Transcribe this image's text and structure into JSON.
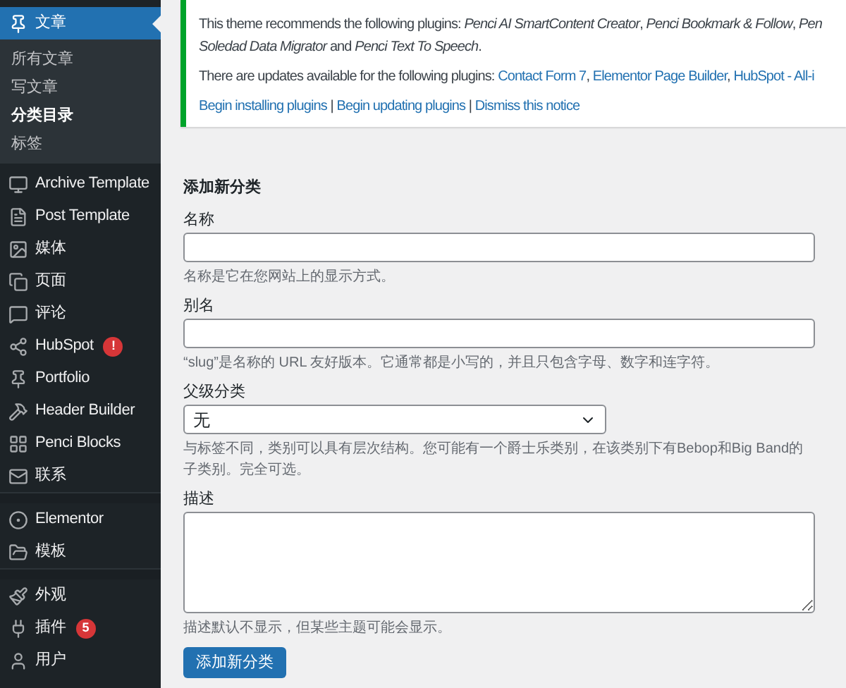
{
  "sidebar": {
    "items": [
      {
        "label": "文章",
        "selected": true,
        "children": [
          {
            "label": "所有文章",
            "selected": false
          },
          {
            "label": "写文章",
            "selected": false
          },
          {
            "label": "分类目录",
            "selected": true
          },
          {
            "label": "标签",
            "selected": false
          }
        ]
      },
      {
        "label": "Archive Template",
        "selected": false
      },
      {
        "label": "Post Template",
        "selected": false
      },
      {
        "label": "媒体",
        "selected": false
      },
      {
        "label": "页面",
        "selected": false
      },
      {
        "label": "评论",
        "selected": false
      },
      {
        "label": "HubSpot",
        "selected": false,
        "badge": "!"
      },
      {
        "label": "Portfolio",
        "selected": false
      },
      {
        "label": "Header Builder",
        "selected": false
      },
      {
        "label": "Penci Blocks",
        "selected": false
      },
      {
        "label": "联系",
        "selected": false
      },
      {
        "label": "Elementor",
        "selected": false,
        "group_start": true
      },
      {
        "label": "模板",
        "selected": false
      },
      {
        "label": "外观",
        "selected": false,
        "group_start": true
      },
      {
        "label": "插件",
        "selected": false,
        "badge": "5"
      },
      {
        "label": "用户",
        "selected": false
      }
    ]
  },
  "notice": {
    "recommend_lines": [
      "This theme recommends the following plugins: *Penci AI SmartContent Creator*, *Penci Bookmark & Follow*, *Pen*",
      "*Soledad Data Migrator* and *Penci Text To Speech*."
    ],
    "updates": [
      {
        "kind": "text",
        "text": "There are updates available for the following plugins: "
      },
      {
        "kind": "link",
        "text": "Contact Form 7"
      },
      {
        "kind": "text",
        "text": ", "
      },
      {
        "kind": "link",
        "text": "Elementor Page Builder"
      },
      {
        "kind": "text",
        "text": ", "
      },
      {
        "kind": "link",
        "text": "HubSpot - All-i"
      }
    ],
    "actions": [
      {
        "kind": "link",
        "text": "Begin installing plugins"
      },
      {
        "kind": "text",
        "text": " | "
      },
      {
        "kind": "link",
        "text": "Begin updating plugins"
      },
      {
        "kind": "text",
        "text": " | "
      },
      {
        "kind": "link",
        "text": "Dismiss this notice"
      }
    ]
  },
  "form": {
    "title": "添加新分类",
    "fields": [
      {
        "kind": "input",
        "label": "名称",
        "help": "名称是它在您网站上的显示方式。"
      },
      {
        "kind": "input",
        "label": "别名",
        "help": "“slug”是名称的 URL 友好版本。它通常都是小写的，并且只包含字母、数字和连字符。"
      },
      {
        "kind": "select",
        "label": "父级分类",
        "value": "无",
        "help": "与标签不同，类别可以具有层次结构。您可能有一个爵士乐类别，在该类别下有Bebop和Big Band的子类别。完全可选。"
      },
      {
        "kind": "textarea",
        "label": "描述",
        "help": "描述默认不显示，但某些主题可能会显示。"
      }
    ],
    "submit": "添加新分类"
  }
}
